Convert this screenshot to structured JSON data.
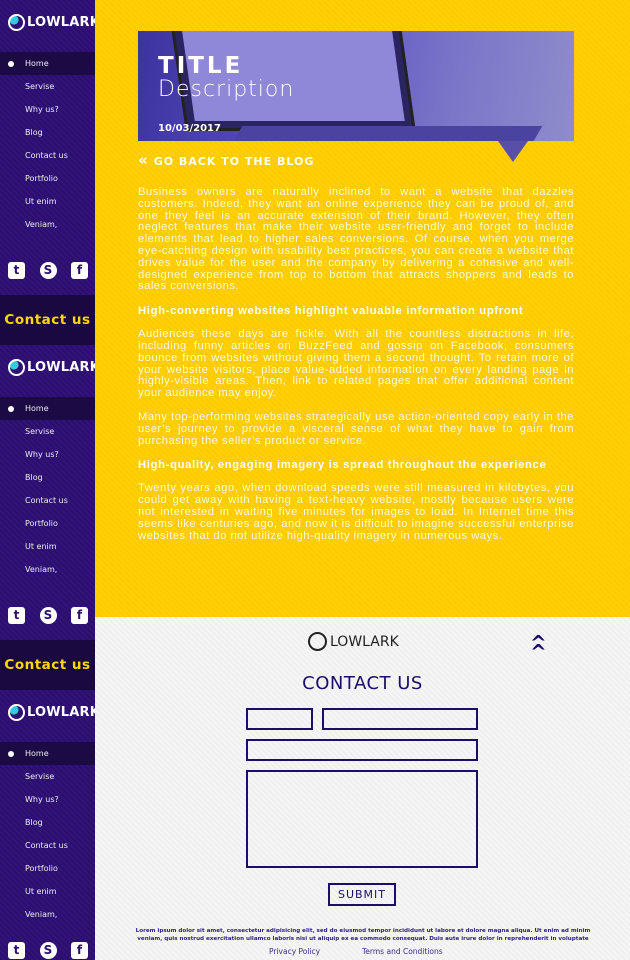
{
  "sidebar": {
    "logo": "LOWLARK",
    "menu": [
      "Home",
      "Servise",
      "Why us?",
      "Blog",
      "Contact us",
      "Portfolio",
      " Ut enim",
      "Veniam,"
    ],
    "active": 0,
    "contact": "Contact us",
    "social": [
      "twitter-icon",
      "skype-icon",
      "facebook-icon"
    ]
  },
  "hero": {
    "title": "TITLE",
    "description": "Description",
    "date": "10/03/2017"
  },
  "back_link": "GO BACK TO THE BLOG",
  "article": {
    "p1": "Business owners are naturally inclined to want a website that dazzles customers. Indeed, they want an online experience they can be proud of, and one they feel is an accurate extension of their brand. However, they often neglect features that make their website user-friendly and forget to include elements that lead to higher sales conversions. Of course, when you merge eye-catching design with usability best practices, you can create a website that drives value for the user and the company by delivering a cohesive and well-designed experience from top to bottom that attracts shoppers and leads to sales conversions.",
    "h1": "High-converting websites highlight valuable information upfront",
    "p2": "Audiences these days are fickle. With all the countless distractions in life, including funny articles on BuzzFeed and gossip on Facebook, consumers bounce from websites without giving them a second thought. To retain more of your website visitors, place value-added information on every landing page in highly-visible areas. Then, link to related pages that offer additional content your audience may enjoy.",
    "p3": "Many top-performing websites strategically use action-oriented copy early in the user’s journey to provide a visceral sense of what they have to gain from purchasing the seller’s product or service.",
    "h2": "High-quality, engaging imagery is spread throughout the experience",
    "p4": "Twenty years ago, when download speeds were still measured in kilobytes, you could get away with having a text-heavy website, mostly because users were not interested in waiting five minutes for images to load. In Internet time this seems like centuries ago, and now it is difficult to imagine successful enterprise websites that do not utilize high-quality imagery in numerous ways."
  },
  "footer": {
    "logo": "LOWLARK",
    "title": "CONTACT US",
    "submit": "SUBMIT",
    "lorem": "Lorem ipsum dolor sit amet, consectetur adipisicing elit, sed do eiusmod tempor incididunt ut labore et dolore magna aliqua. Ut enim ad minim veniam, quis nostrud exercitation ullamco laboris nisi ut aliquip ex ea commodo consequat. Duis aute irure dolor in reprehenderit in voluptate",
    "privacy": "Privacy Policy",
    "terms": "Terms and Conditions"
  },
  "colors": {
    "yellow": "#ffcb00",
    "purple": "#2b0e6e",
    "navy": "#1c0d6b"
  }
}
